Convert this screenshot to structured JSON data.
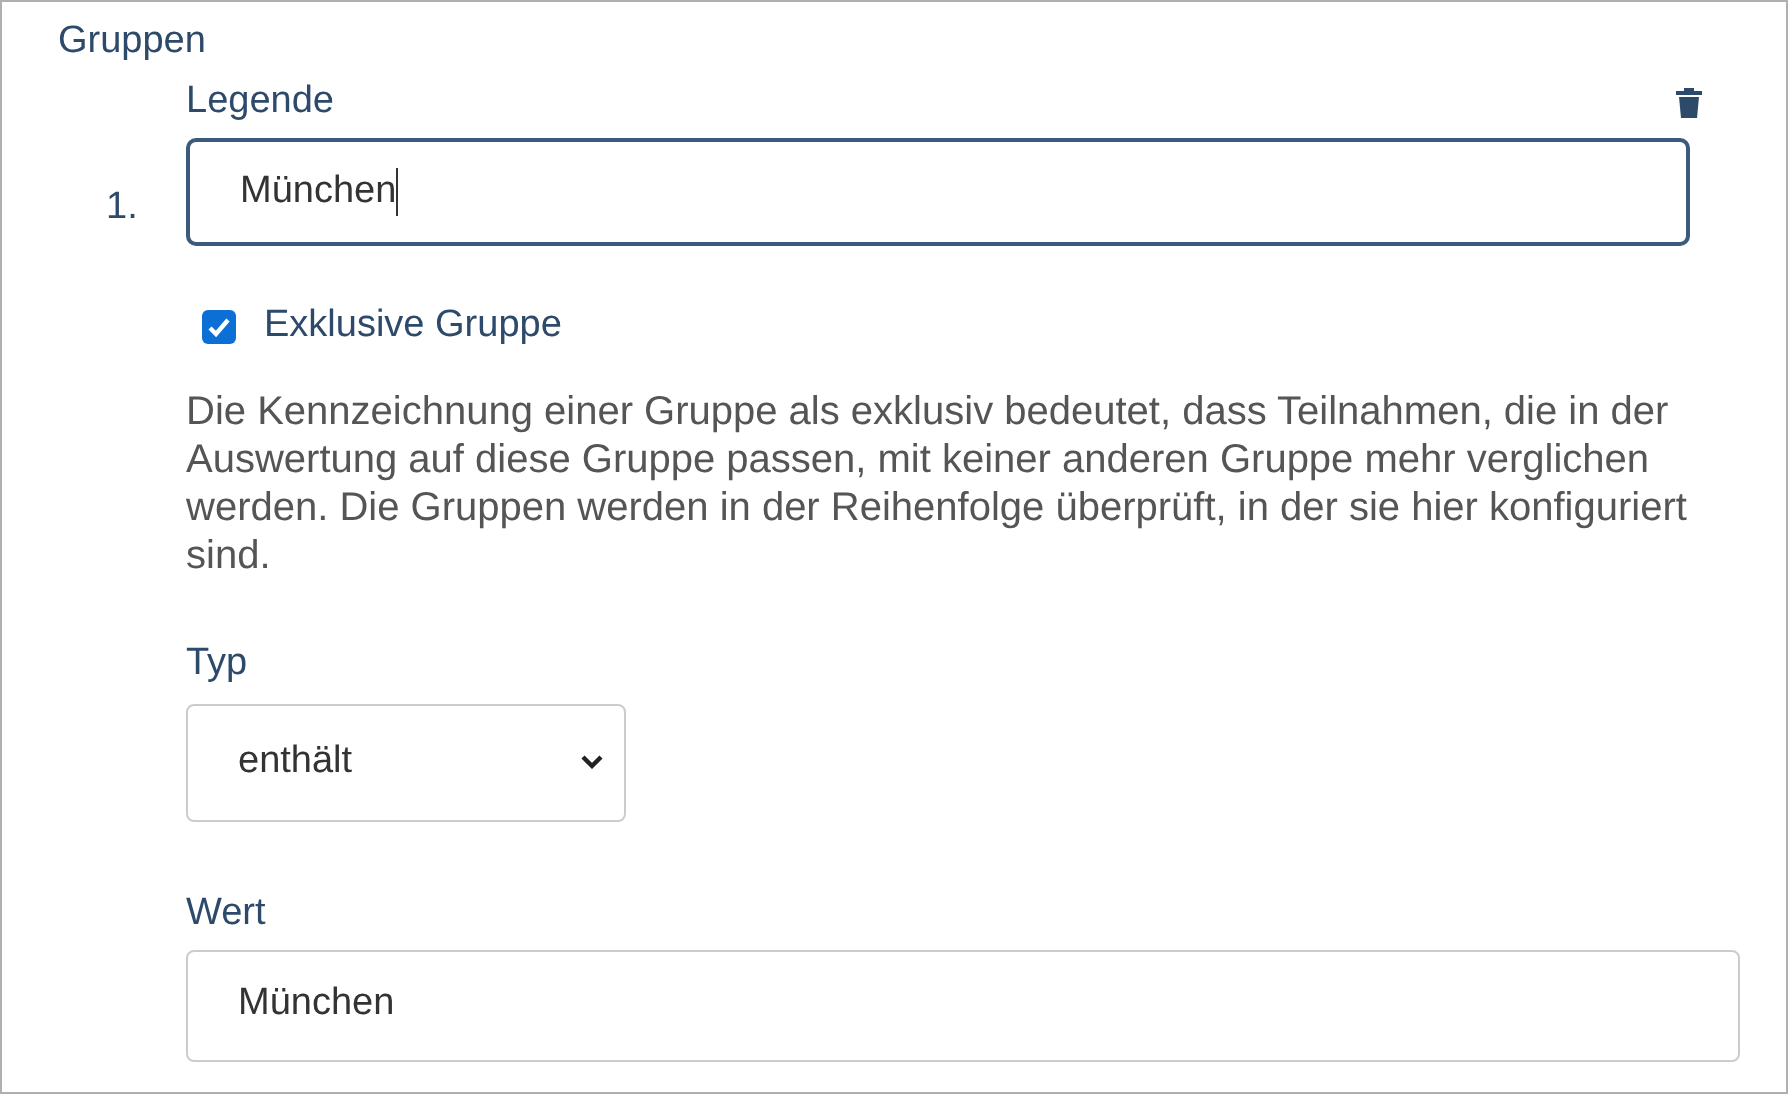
{
  "section_title": "Gruppen",
  "groups": [
    {
      "number": "1.",
      "legend_label": "Legende",
      "legend_value": "München",
      "legend_focused": true,
      "exclusive": {
        "label": "Exklusive Gruppe",
        "checked": true
      },
      "description": "Die Kennzeichnung einer Gruppe als exklusiv bedeutet, dass Teilnahmen, die in der Auswertung auf diese Gruppe passen, mit keiner anderen Gruppe mehr verglichen werden. Die Gruppen werden in der Reihenfolge überprüft, in der sie hier konfiguriert sind.",
      "type_label": "Typ",
      "type_value": "enthält",
      "value_label": "Wert",
      "value": "München"
    }
  ]
}
